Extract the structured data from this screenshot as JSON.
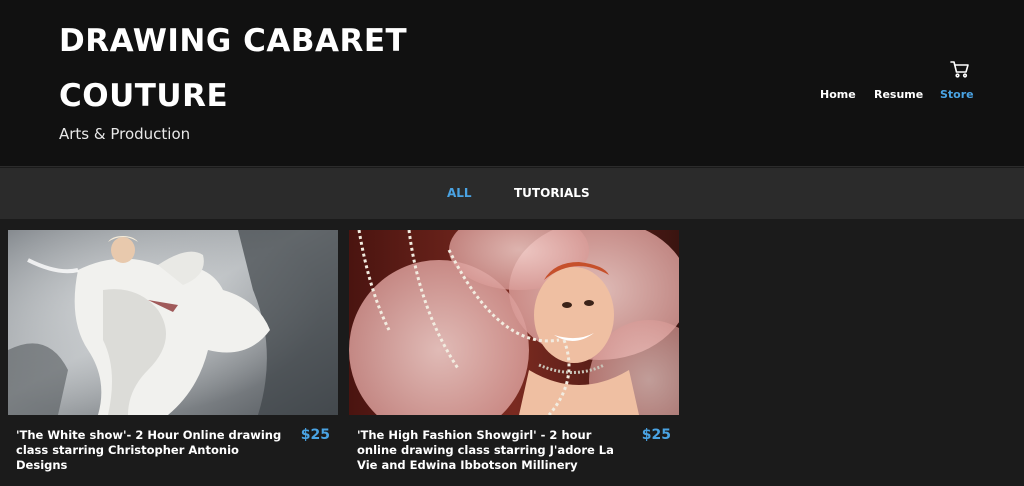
{
  "site": {
    "title": "DRAWING CABARET COUTURE",
    "tagline": "Arts & Production",
    "cart_icon": "shopping-cart-icon"
  },
  "nav": {
    "items": [
      {
        "label": "Home",
        "active": false
      },
      {
        "label": "Resume",
        "active": false
      },
      {
        "label": "Store",
        "active": true
      }
    ]
  },
  "filters": {
    "items": [
      {
        "label": "ALL",
        "active": true
      },
      {
        "label": "TUTORIALS",
        "active": false
      }
    ]
  },
  "products": [
    {
      "name": "'The White show'- 2 Hour Online drawing class starring Christopher Antonio Designs",
      "price": "$25"
    },
    {
      "name": "'The High Fashion Showgirl' - 2 hour online drawing class starring J'adore La Vie and Edwina Ibbotson Millinery",
      "price": "$25"
    }
  ],
  "colors": {
    "accent": "#4aa3e3",
    "header_bg": "#111111",
    "page_bg": "#1b1b1b",
    "filterbar_bg": "#2b2b2b"
  }
}
